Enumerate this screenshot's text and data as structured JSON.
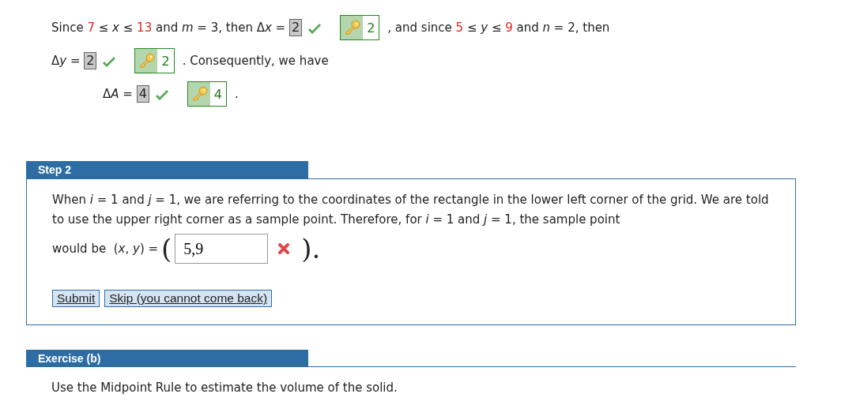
{
  "intro_lines": [
    {
      "kind": "text",
      "parts": [
        {
          "kind": "text",
          "text": "Since "
        },
        {
          "kind": "given",
          "text": "7"
        },
        {
          "kind": "text",
          "text": " ≤ *x* ≤ "
        },
        {
          "kind": "given",
          "text": "13"
        },
        {
          "kind": "text",
          "text": " and *m* = 3, then Δ"
        },
        {
          "kind": "text",
          "text": "*x* = "
        },
        {
          "kind": "answer",
          "text": "2",
          "correct": true
        },
        {
          "kind": "key",
          "text": "2"
        },
        {
          "kind": "text",
          "text": ", and since "
        },
        {
          "kind": "given",
          "text": "5"
        },
        {
          "kind": "text",
          "text": " ≤ *y* ≤ "
        },
        {
          "kind": "given",
          "text": "9"
        },
        {
          "kind": "text",
          "text": " and *n* = 2, then"
        }
      ]
    },
    {
      "kind": "text",
      "parts": [
        {
          "kind": "text",
          "text": "Δ"
        },
        {
          "kind": "text",
          "text": "*y* = "
        },
        {
          "kind": "answer",
          "text": "2",
          "correct": true
        },
        {
          "kind": "key",
          "text": "2"
        },
        {
          "kind": "text",
          "text": ". Consequently, we have"
        }
      ]
    },
    {
      "kind": "display",
      "parts": [
        {
          "kind": "text",
          "text": "Δ"
        },
        {
          "kind": "text",
          "text": "*A* = "
        },
        {
          "kind": "answer",
          "text": "4",
          "correct": true
        },
        {
          "kind": "key",
          "text": "4"
        },
        {
          "kind": "text",
          "text": "."
        }
      ]
    }
  ],
  "step": {
    "title": "Step 2",
    "paragraph": "When *i* = 1 and *j* = 1, we are referring to the coordinates of the rectangle in the lower left corner of the grid. We are told to use the upper right corner as a sample point. Therefore, for *i* = 1 and *j* = 1, the sample point",
    "answer_label": "would be  (*x*, *y*) =",
    "open_paren": "(",
    "answer": {
      "value": "5,9",
      "correct": false
    },
    "close_paren": ").",
    "buttons": [
      "Submit",
      "Skip (you cannot come back)"
    ]
  },
  "exercise": {
    "title": "Exercise (b)",
    "text": "Use the Midpoint Rule to estimate the volume of the solid."
  }
}
